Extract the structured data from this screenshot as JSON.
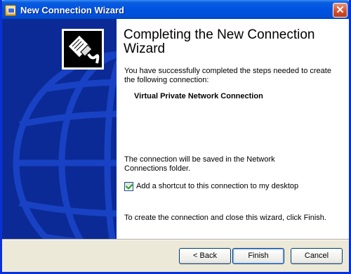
{
  "window": {
    "title": "New Connection Wizard"
  },
  "content": {
    "heading": "Completing the New Connection Wizard",
    "intro": "You have successfully completed the steps needed to create the following connection:",
    "connection_name": "Virtual Private Network Connection",
    "save_note": "The connection will be saved in the Network Connections folder.",
    "shortcut_label": "Add a shortcut to this connection to my desktop",
    "shortcut_checked": true,
    "finish_note": "To create the connection and close this wizard, click Finish."
  },
  "buttons": {
    "back": "< Back",
    "finish": "Finish",
    "cancel": "Cancel"
  },
  "icons": {
    "app": "network-connection-icon",
    "wizard": "network-cable-icon",
    "close": "close-icon",
    "banner": "globe-icon"
  },
  "colors": {
    "title_bar": "#0054e3",
    "banner": "#0b2a96",
    "dialog": "#ece9d8",
    "check": "#21a121"
  }
}
